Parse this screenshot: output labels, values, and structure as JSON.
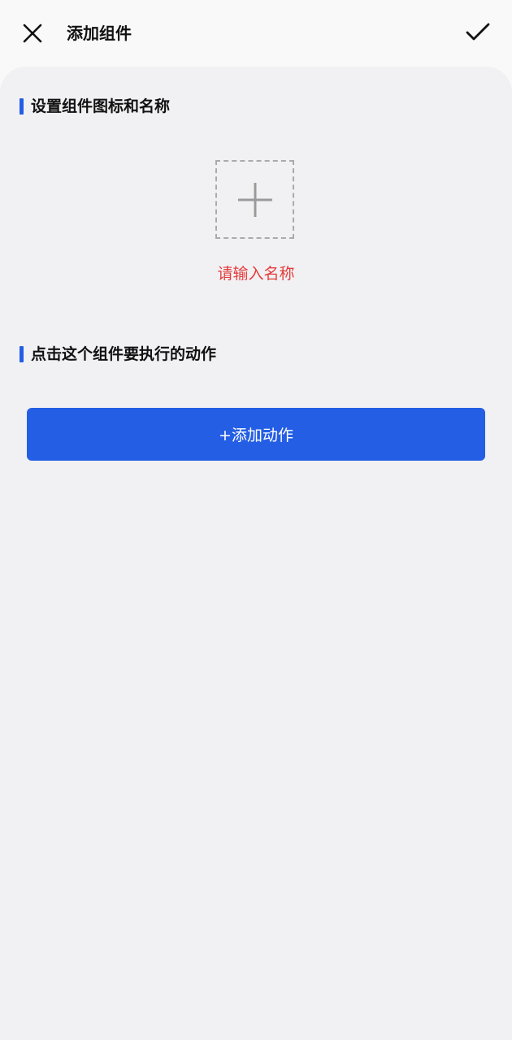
{
  "header": {
    "title": "添加组件",
    "close_icon": "close-icon",
    "confirm_icon": "checkmark-icon"
  },
  "section_icon_name": {
    "heading": "设置组件图标和名称",
    "upload_icon": "plus-icon",
    "name_placeholder": "请输入名称"
  },
  "section_action": {
    "heading": "点击这个组件要执行的动作",
    "add_action_label": "+添加动作"
  },
  "colors": {
    "accent": "#245ee4",
    "error_red": "#e53b3b",
    "background": "#f1f1f3"
  }
}
